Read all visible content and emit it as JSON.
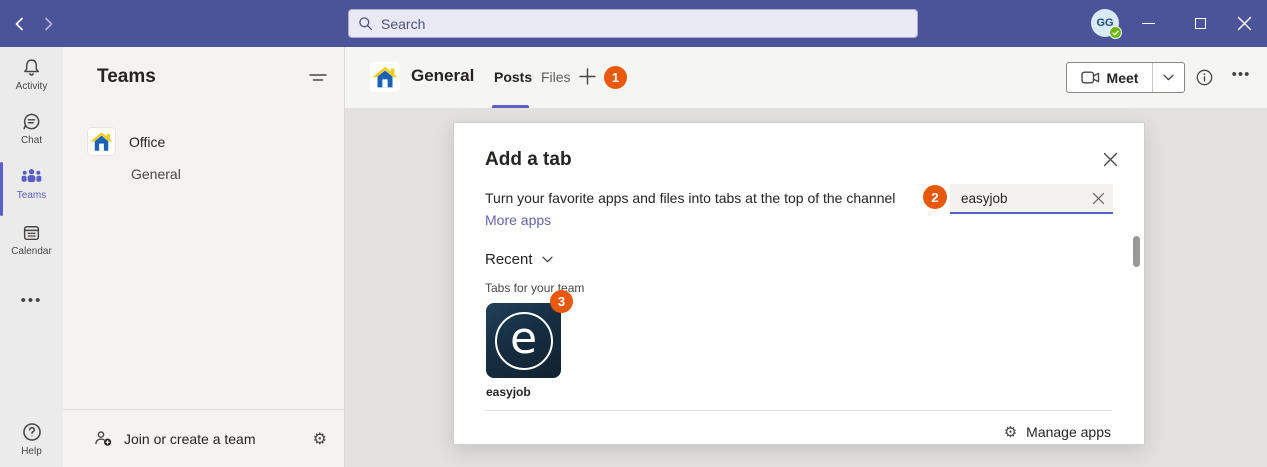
{
  "colors": {
    "titlebar_purple": "#4C5499",
    "accent_purple": "#5B5FC7",
    "link_purple": "#6264A7",
    "badge_orange": "#E8590C",
    "presence_green": "#6BB700",
    "app_tile_navy": "#16293A"
  },
  "titlebar": {
    "search_placeholder": "Search",
    "avatar_initials": "GG"
  },
  "rail": {
    "items": [
      {
        "label": "Activity"
      },
      {
        "label": "Chat"
      },
      {
        "label": "Teams"
      },
      {
        "label": "Calendar"
      }
    ],
    "selected": "Teams",
    "overflow_icon": "•••",
    "help_label": "Help"
  },
  "teams_panel": {
    "title": "Teams",
    "team_name": "Office",
    "channel_name": "General",
    "join_label": "Join or create a team"
  },
  "channel_header": {
    "title": "General",
    "tabs": [
      {
        "label": "Posts",
        "active": true
      },
      {
        "label": "Files",
        "active": false
      }
    ],
    "add_tab_badge": "1",
    "meet_label": "Meet",
    "more_icon": "•••"
  },
  "dialog": {
    "title": "Add a tab",
    "description": "Turn your favorite apps and files into tabs at the top of the channel",
    "more_apps_link": "More apps",
    "search_badge": "2",
    "search_value": "easyjob",
    "recent_label": "Recent",
    "section_label": "Tabs for your team",
    "app_badge": "3",
    "app_name": "easyjob",
    "app_letter": "e",
    "manage_apps_label": "Manage apps"
  }
}
